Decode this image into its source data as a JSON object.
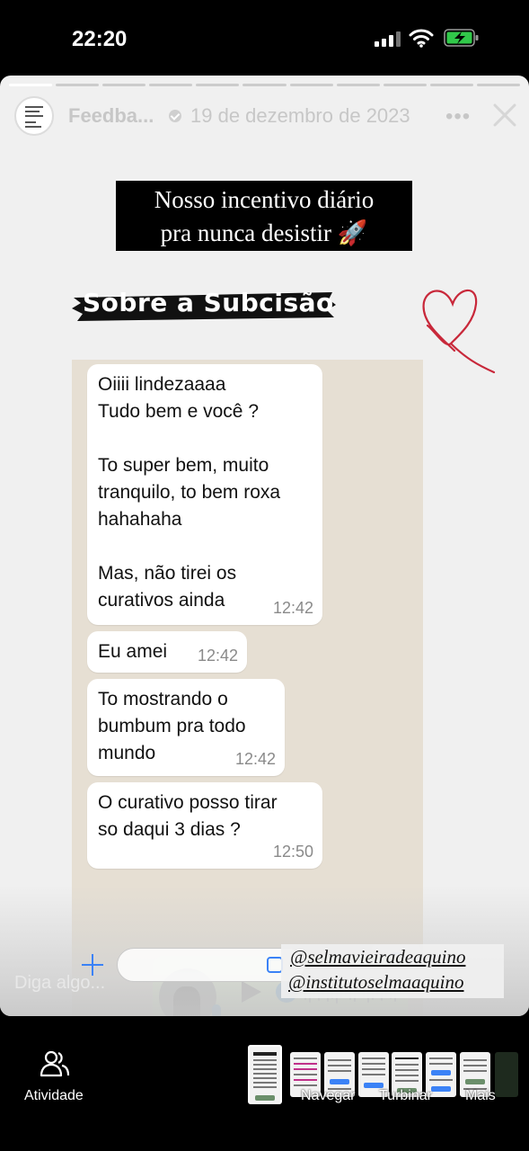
{
  "status_bar": {
    "time": "22:20"
  },
  "story": {
    "author": "Feedba...",
    "date": "19 de dezembro de 2023",
    "more_icon": "more-horizontal-icon",
    "close_icon": "close-icon",
    "progress_segments": 11,
    "active_segment": 1
  },
  "banner": {
    "line1": "Nosso incentivo diário",
    "line2": "pra nunca desistir 🚀"
  },
  "subtitle": "Sobre a Subcisão",
  "chat": {
    "messages": [
      {
        "text": "Oiiii lindezaaaa\nTudo bem e você ?\n\nTo super bem, muito\ntranquilo, to bem roxa\nhahahaha\n\nMas, não tirei os\ncurativos ainda",
        "time": "12:42"
      },
      {
        "text": "Eu amei",
        "time": "12:42"
      },
      {
        "text": "To mostrando o\nbumbum pra todo\nmundo",
        "time": "12:42"
      },
      {
        "text": "O curativo posso tirar\nso daqui 3 dias ?",
        "time": "12:50"
      }
    ],
    "audio_message": {
      "play_icon": "play-icon",
      "mic_icon": "mic-icon"
    },
    "scroll_icon": "chevron-down-circle-icon"
  },
  "reply": {
    "placeholder": "Diga algo..."
  },
  "mentions": [
    "@selmavieiradeaquino",
    "@institutoselmaaquino"
  ],
  "bottom_nav": {
    "activity_label": "Atividade",
    "navigate_label": "Navegar",
    "boost_label": "Turbinar",
    "more_label": "Mais"
  },
  "colors": {
    "chat_background": "#e6dfd3",
    "accent": "#3b82f6",
    "audio_bubble": "#dcf8c6",
    "heart": "#c8283a"
  }
}
